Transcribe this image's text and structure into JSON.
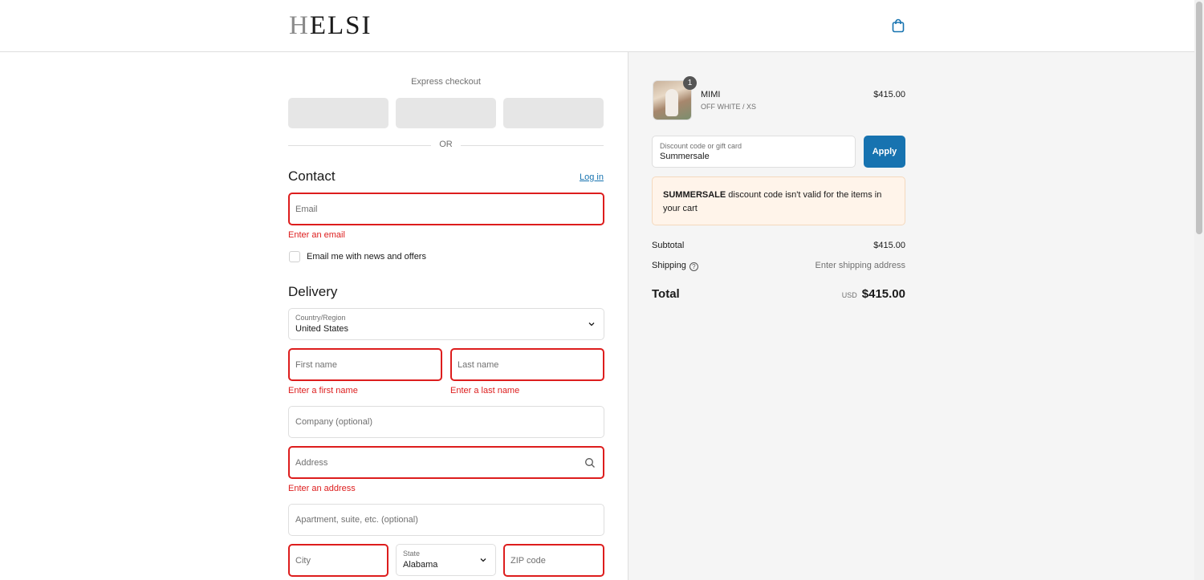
{
  "brand": {
    "logo_first": "H",
    "logo_rest": "ELSI"
  },
  "express": {
    "title": "Express checkout",
    "or_label": "OR"
  },
  "contact": {
    "heading": "Contact",
    "login_label": "Log in",
    "email_placeholder": "Email",
    "email_error": "Enter an email",
    "newsletter_label": "Email me with news and offers"
  },
  "delivery": {
    "heading": "Delivery",
    "country_label": "Country/Region",
    "country_value": "United States",
    "first_name_placeholder": "First name",
    "first_name_error": "Enter a first name",
    "last_name_placeholder": "Last name",
    "last_name_error": "Enter a last name",
    "company_placeholder": "Company (optional)",
    "address_placeholder": "Address",
    "address_error": "Enter an address",
    "apartment_placeholder": "Apartment, suite, etc. (optional)",
    "city_placeholder": "City",
    "state_label": "State",
    "state_value": "Alabama",
    "zip_placeholder": "ZIP code"
  },
  "summary": {
    "product": {
      "name": "MIMI",
      "variant": "OFF WHITE / XS",
      "price": "$415.00",
      "quantity": "1"
    },
    "discount_label": "Discount code or gift card",
    "discount_value": "Summersale",
    "apply_label": "Apply",
    "notice_code": "SUMMERSALE",
    "notice_text": " discount code isn't valid for the items in your cart",
    "subtotal_label": "Subtotal",
    "subtotal_value": "$415.00",
    "shipping_label": "Shipping",
    "shipping_value": "Enter shipping address",
    "total_label": "Total",
    "total_currency": "USD",
    "total_value": "$415.00"
  },
  "colors": {
    "accent": "#1773b0",
    "error": "#dd1d1d",
    "notice_bg": "#fff4ea"
  }
}
